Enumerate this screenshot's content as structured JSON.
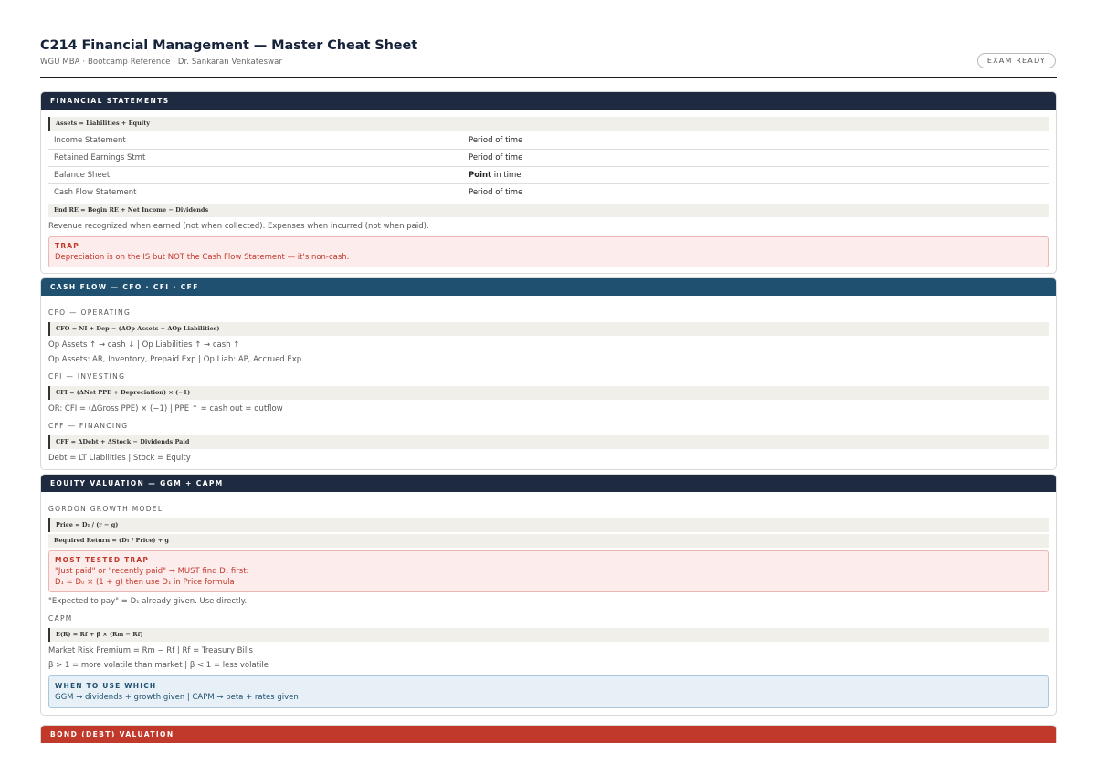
{
  "header": {
    "title": "C214 Financial Management — Master Cheat Sheet",
    "subtitle": "WGU MBA · Bootcamp Reference · Dr. Sankaran Venkateswar",
    "badge": "EXAM READY"
  },
  "fs": {
    "title": "FINANCIAL STATEMENTS",
    "formula1": "Assets = Liabilities + Equity",
    "rows": [
      {
        "name": "Income Statement",
        "pre": "",
        "value": "Period of time"
      },
      {
        "name": "Retained Earnings Stmt",
        "pre": "",
        "value": "Period of time"
      },
      {
        "name": "Balance Sheet",
        "pre": "Point",
        "value": " in time"
      },
      {
        "name": "Cash Flow Statement",
        "pre": "",
        "value": "Period of time"
      }
    ],
    "formula2": "End RE = Begin RE + Net Income − Dividends",
    "note": "Revenue recognized when earned (not when collected). Expenses when incurred (not when paid).",
    "trap_title": "TRAP",
    "trap_text": "Depreciation is on the IS but NOT the Cash Flow Statement — it's non-cash."
  },
  "cf": {
    "title": "CASH FLOW — CFO · CFI · CFF",
    "cfo_label": "CFO — OPERATING",
    "cfo_formula": "CFO = NI + Dep − (ΔOp Assets − ΔOp Liabilities)",
    "cfo_note1": "Op Assets ↑ → cash ↓  |  Op Liabilities ↑ → cash ↑",
    "cfo_note2": "Op Assets: AR, Inventory, Prepaid Exp  |  Op Liab: AP, Accrued Exp",
    "cfi_label": "CFI — INVESTING",
    "cfi_formula": "CFI = (ΔNet PPE + Depreciation) × (−1)",
    "cfi_note": "OR: CFI = (ΔGross PPE) × (−1)  |  PPE ↑ = cash out = outflow",
    "cff_label": "CFF — FINANCING",
    "cff_formula": "CFF = ΔDebt + ΔStock − Dividends Paid",
    "cff_note": "Debt = LT Liabilities  |  Stock = Equity"
  },
  "eq": {
    "title": "EQUITY VALUATION — GGM + CAPM",
    "ggm_label": "GORDON GROWTH MODEL",
    "ggm_formula1": "Price = D₁ / (r − g)",
    "ggm_formula2": "Required Return = (D₁ / Price) + g",
    "trap_title": "MOST TESTED TRAP",
    "trap_line1": "\"Just paid\" or \"recently paid\" → MUST find D₁ first:",
    "trap_line2": "D₁ = D₀ × (1 + g)   then use D₁ in Price formula",
    "ggm_note": "\"Expected to pay\" = D₁ already given. Use directly.",
    "capm_label": "CAPM",
    "capm_formula": "E(R) = Rf + β × (Rm − Rf)",
    "capm_note1": "Market Risk Premium = Rm − Rf  |  Rf = Treasury Bills",
    "capm_note2": "β > 1 = more volatile than market  |  β < 1 = less volatile",
    "info_title": "WHEN TO USE WHICH",
    "info_text": "GGM → dividends + growth given  |  CAPM → beta + rates given"
  },
  "bond": {
    "title": "BOND (DEBT) VALUATION"
  }
}
